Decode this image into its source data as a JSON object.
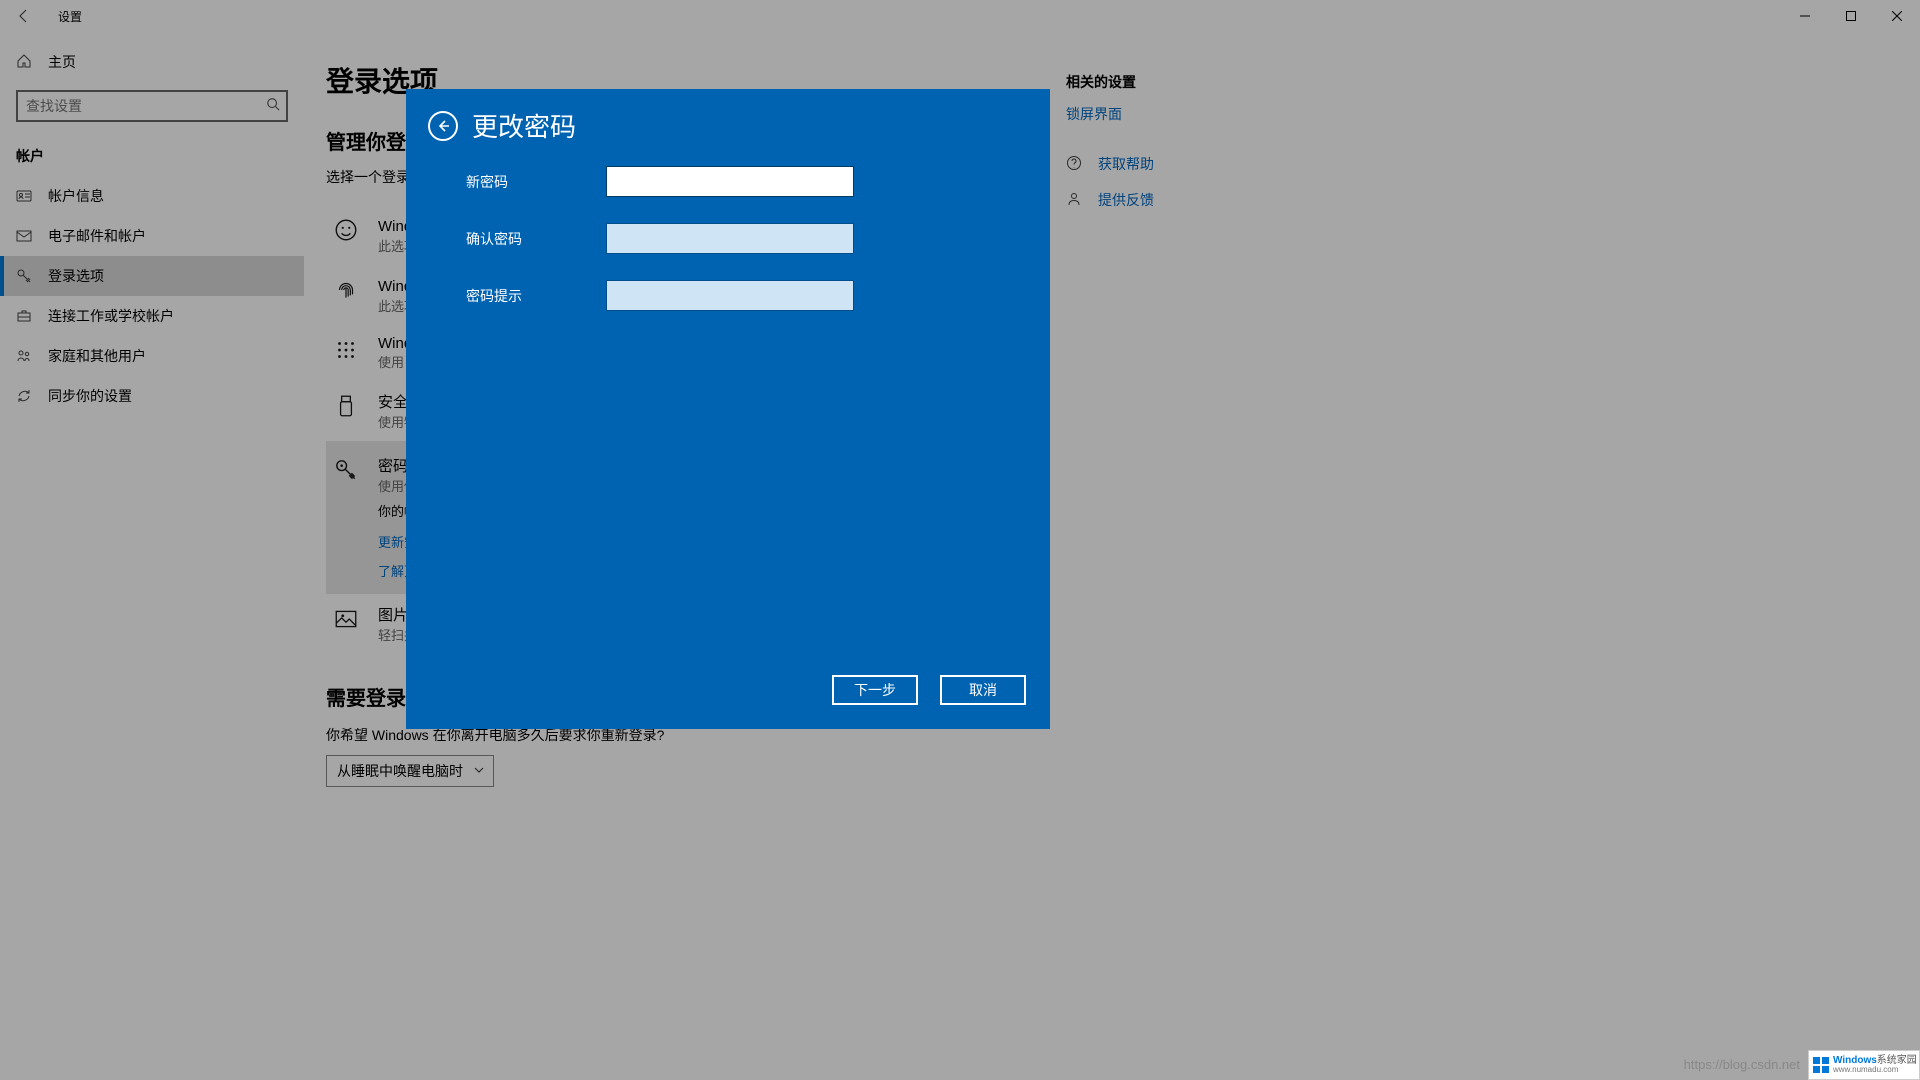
{
  "titlebar": {
    "title": "设置"
  },
  "sidebar": {
    "home": "主页",
    "search_placeholder": "查找设置",
    "section": "帐户",
    "items": [
      {
        "label": "帐户信息"
      },
      {
        "label": "电子邮件和帐户"
      },
      {
        "label": "登录选项"
      },
      {
        "label": "连接工作或学校帐户"
      },
      {
        "label": "家庭和其他用户"
      },
      {
        "label": "同步你的设置"
      }
    ]
  },
  "main": {
    "h1": "登录选项",
    "h2": "管理你登录设备的方式",
    "hint": "选择一个登录选项，添加、更改或删除它。",
    "options": [
      {
        "title": "Windows Hello 人脸",
        "sub": "此选项当前不可用"
      },
      {
        "title": "Windows Hello 指纹",
        "sub": "此选项当前不可用"
      },
      {
        "title": "Windows Hello PIN",
        "sub": "使用 PIN 登录(推荐)"
      },
      {
        "title": "安全密钥",
        "sub": "使用物理安全密钥登录"
      },
      {
        "title": "密码",
        "sub": "使用你的帐户密码登录",
        "desc": "你的帐户密码已经设置，可以用来登录 Windows、应用和服务。",
        "link1": "更新安全问题",
        "link2": "了解更多"
      },
      {
        "title": "图片密码",
        "sub": "轻扫并点击最喜爱的照片以解锁设备"
      }
    ],
    "require_h2": "需要登录",
    "require_q": "你希望 Windows 在你离开电脑多久后要求你重新登录?",
    "dropdown": "从睡眠中唤醒电脑时"
  },
  "right": {
    "heading": "相关的设置",
    "lock": "锁屏界面",
    "help": "获取帮助",
    "feedback": "提供反馈"
  },
  "modal": {
    "title": "更改密码",
    "new_pw": "新密码",
    "confirm_pw": "确认密码",
    "hint_pw": "密码提示",
    "next": "下一步",
    "cancel": "取消"
  },
  "footer": {
    "url": "https://blog.csdn.net",
    "wm1": "Windows",
    "wm2": "系统家园",
    "wm3": "www.numadu.com"
  }
}
